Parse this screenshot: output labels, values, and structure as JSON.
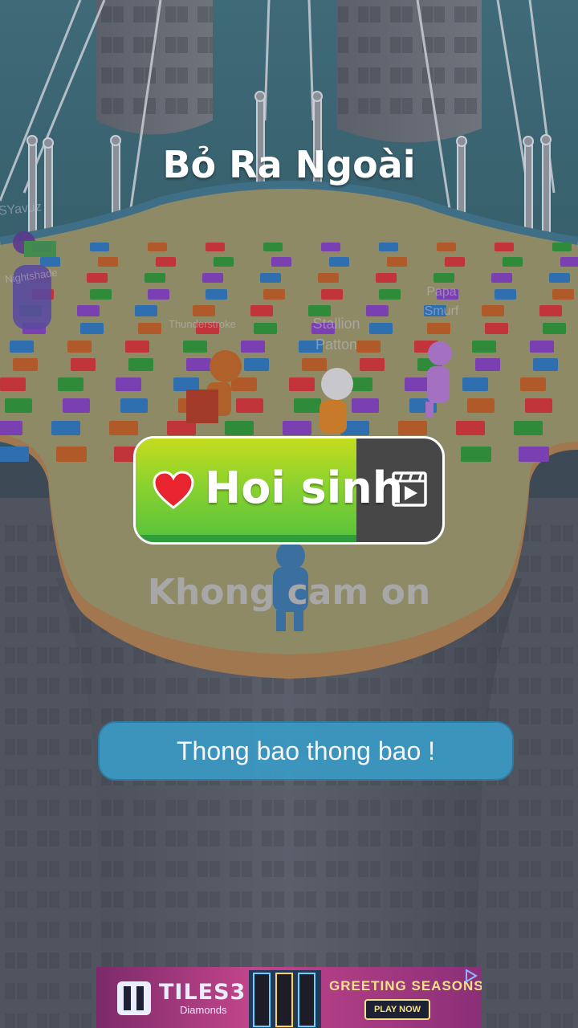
{
  "dialog": {
    "title": "Bỏ Ra Ngoài",
    "revive_label": "Hoi sinh",
    "revive_progress": 0.72,
    "decline_label": "Khong cam on"
  },
  "toast": {
    "text": "Thong bao thong bao !"
  },
  "players": [
    "SYavuz",
    "Nightshade",
    "Thunderstroke",
    "Stallion Patton",
    "Papa Smurf"
  ],
  "ad": {
    "logo": "TILES3",
    "logo_sub": "Diamonds",
    "promo": "GREETING SEASONS",
    "cta": "PLAY NOW"
  },
  "icons": {
    "revive": "heart-icon",
    "video": "video-ad-icon",
    "ad_badge": "ad-choices-icon"
  },
  "colors": {
    "revive_fill": "#8bd22e",
    "revive_track": "#474747",
    "toast_bg": "#3b98c2",
    "heart": "#e8242e"
  }
}
